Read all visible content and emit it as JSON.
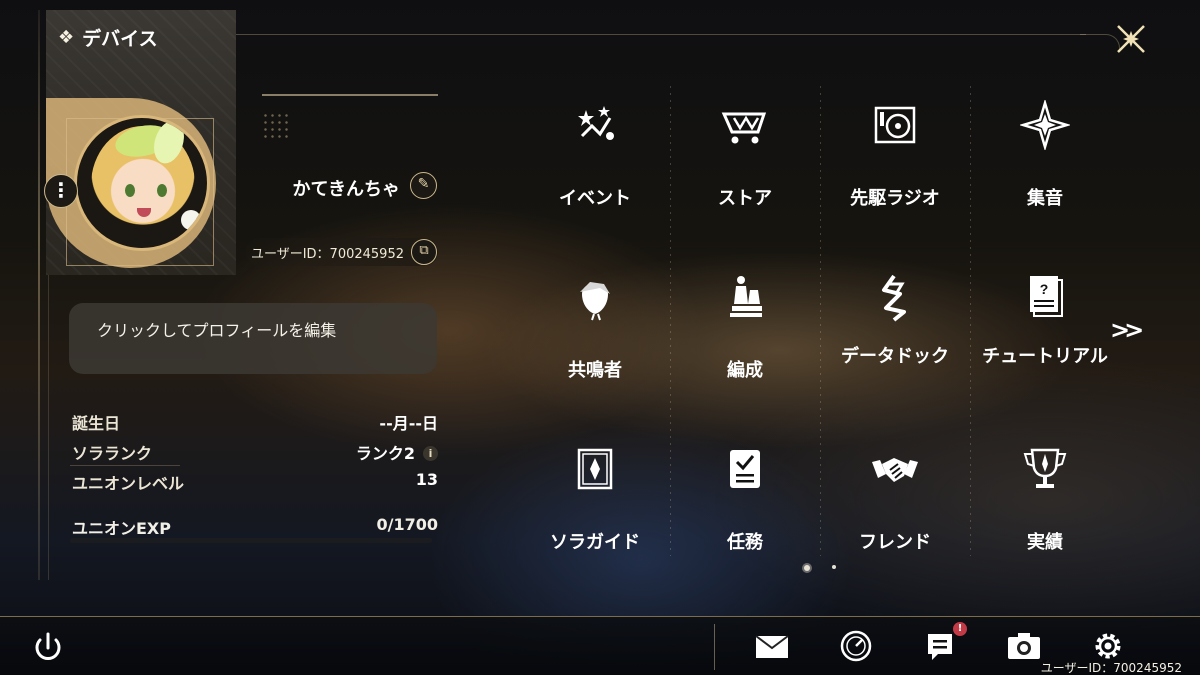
{
  "header": {
    "title": "デバイス"
  },
  "profile": {
    "username": "かてきんちゃ",
    "user_id_label": "ユーザーID：700245952",
    "bio_placeholder": "クリックしてプロフィールを編集"
  },
  "stats": [
    {
      "label": "誕生日",
      "value": "--月--日"
    },
    {
      "label": "ソラランク",
      "value": "ランク2"
    },
    {
      "label": "ユニオンレベル",
      "value": "13"
    }
  ],
  "exp": {
    "label": "ユニオンEXP",
    "value": "0/1700",
    "progress": 0
  },
  "menu": [
    {
      "label": "イベント",
      "icon": "event-icon"
    },
    {
      "label": "ストア",
      "icon": "store-cart-icon"
    },
    {
      "label": "先駆ラジオ",
      "icon": "radio-icon"
    },
    {
      "label": "集音",
      "icon": "compass-star-icon"
    },
    {
      "label": "共鳴者",
      "icon": "resonator-head-icon"
    },
    {
      "label": "編成",
      "icon": "chess-piece-icon"
    },
    {
      "label": "データドック",
      "icon": "data-dock-icon"
    },
    {
      "label": "チュートリアル",
      "icon": "tutorial-book-icon"
    },
    {
      "label": "ソラガイド",
      "icon": "guide-book-icon"
    },
    {
      "label": "任務",
      "icon": "mission-clipboard-icon"
    },
    {
      "label": "フレンド",
      "icon": "handshake-icon"
    },
    {
      "label": "実績",
      "icon": "trophy-icon"
    }
  ],
  "pagination": {
    "pages": 2,
    "current": 1
  },
  "bottom_bar": {
    "icons": [
      "mail-icon",
      "clock-icon",
      "notice-icon",
      "camera-icon",
      "settings-gear-icon"
    ],
    "notice_badge": "!",
    "user_id_footer": "ユーザーID：700245952"
  },
  "colors": {
    "accent": "#d9b77a",
    "badge": "#c23a45"
  }
}
